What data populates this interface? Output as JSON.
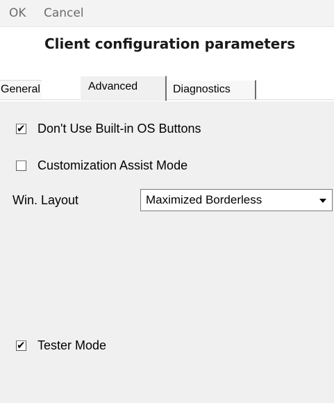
{
  "menu": {
    "ok_label": "OK",
    "cancel_label": "Cancel"
  },
  "title": "Client configuration parameters",
  "tabs": [
    {
      "label": "General",
      "active": false
    },
    {
      "label": "Advanced",
      "active": true
    },
    {
      "label": "Diagnostics",
      "active": false
    }
  ],
  "advanced": {
    "dont_use_os_buttons": {
      "label": "Don't Use Built-in OS Buttons",
      "checked": true
    },
    "customization_assist": {
      "label": "Customization Assist Mode",
      "checked": false
    },
    "win_layout": {
      "label": "Win. Layout",
      "value": "Maximized Borderless"
    },
    "tester_mode": {
      "label": "Tester Mode",
      "checked": true
    }
  },
  "icons": {
    "checkmark": "✔",
    "dropdown": "chevron-down-icon"
  }
}
